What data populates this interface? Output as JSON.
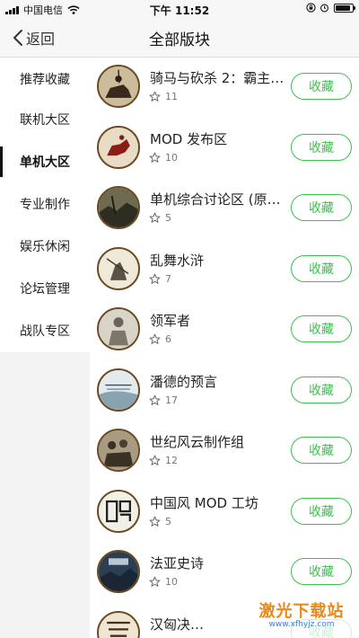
{
  "status_bar": {
    "carrier": "中国电信",
    "time": "下午 11:52",
    "battery_level": 0.9
  },
  "nav": {
    "back_label": "返回",
    "title": "全部版块"
  },
  "sidebar": {
    "items": [
      {
        "label": "推荐收藏",
        "active": false
      },
      {
        "label": "联机大区",
        "active": false
      },
      {
        "label": "单机大区",
        "active": true
      },
      {
        "label": "专业制作",
        "active": false
      },
      {
        "label": "娱乐休闲",
        "active": false
      },
      {
        "label": "论坛管理",
        "active": false
      },
      {
        "label": "战队专区",
        "active": false
      }
    ]
  },
  "forums": [
    {
      "name": "骑马与砍杀 2：霸主…",
      "stars": "11",
      "button": "收藏",
      "icon": "knight-on-horse-icon"
    },
    {
      "name": "MOD 发布区",
      "stars": "10",
      "button": "收藏",
      "icon": "rider-emblem-icon"
    },
    {
      "name": "单机综合讨论区 (原…",
      "stars": "5",
      "button": "收藏",
      "icon": "battle-scene-icon"
    },
    {
      "name": "乱舞水浒",
      "stars": "7",
      "button": "收藏",
      "icon": "ink-warrior-icon"
    },
    {
      "name": "领军者",
      "stars": "6",
      "button": "收藏",
      "icon": "commander-icon"
    },
    {
      "name": "潘德的预言",
      "stars": "17",
      "button": "收藏",
      "icon": "prophesy-of-pendor-icon"
    },
    {
      "name": "世纪风云制作组",
      "stars": "12",
      "button": "收藏",
      "icon": "soldiers-group-icon"
    },
    {
      "name": "中国风 MOD 工坊",
      "stars": "5",
      "button": "收藏",
      "icon": "seal-script-icon"
    },
    {
      "name": "法亚史诗",
      "stars": "10",
      "button": "收藏",
      "icon": "epic-scene-icon"
    },
    {
      "name": "汉匈决…",
      "stars": "",
      "button": "收藏",
      "icon": "han-xiongnu-icon"
    }
  ],
  "watermark": {
    "main": "激光下载站",
    "sub": "www.xfhyjz.com"
  },
  "colors": {
    "accent_green": "#3cc04f",
    "sidebar_bg": "#f3f3f3",
    "nav_bg": "#f7f7f7"
  }
}
